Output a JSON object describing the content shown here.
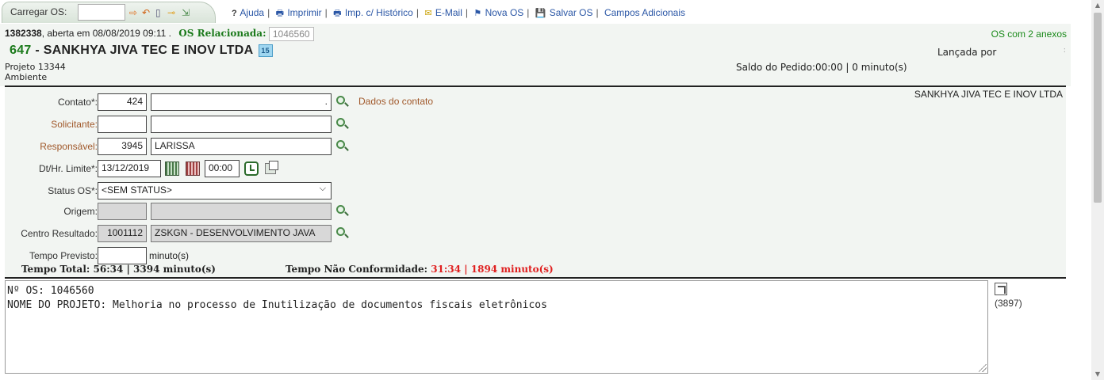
{
  "toolbar": {
    "load_label": "Carregar OS:",
    "load_value": "",
    "menu": [
      {
        "icon": "?",
        "label": "Ajuda"
      },
      {
        "icon": "🖶",
        "label": "Imprimir"
      },
      {
        "icon": "🖶",
        "label": "Imp. c/ Histórico"
      },
      {
        "icon": "✉",
        "label": "E-Mail"
      },
      {
        "icon": "⚑",
        "label": "Nova OS"
      },
      {
        "icon": "💾",
        "label": "Salvar OS"
      },
      {
        "icon": "",
        "label": "Campos Adicionais"
      }
    ]
  },
  "header": {
    "os_number": "1382338",
    "opened_text": ", aberta em 08/08/2019 09:11 .",
    "related_label": "OS Relacionada:",
    "related_value": "1046560",
    "attachments": "OS com 2 anexos",
    "company_code": "647",
    "company_sep": " - ",
    "company_name": "SANKHYA JIVA TEC E INOV LTDA",
    "calendar_badge": "15",
    "project": "Projeto 13344",
    "environment": "Ambiente",
    "launched_by": "Lançada por",
    "colon": ":",
    "balance": "Saldo do Pedido:00:00 | 0 minuto(s)"
  },
  "form": {
    "client_name": "SANKHYA JIVA TEC E INOV LTDA",
    "contato": {
      "label": "Contato*:",
      "code": "424",
      "name": "."
    },
    "contact_link": "Dados do contato",
    "solicitante": {
      "label": "Solicitante:",
      "code": "",
      "name": ""
    },
    "responsavel": {
      "label": "Responsável:",
      "code": "3945",
      "name": "LARISSA"
    },
    "limite": {
      "label": "Dt/Hr. Limite*:",
      "date": "13/12/2019",
      "time": "00:00"
    },
    "status": {
      "label": "Status OS*:",
      "value": "<SEM STATUS>"
    },
    "origem": {
      "label": "Origem:",
      "code": "",
      "name": ""
    },
    "centro": {
      "label": "Centro Resultado:",
      "code": "1001112",
      "name": "ZSKGN - DESENVOLVIMENTO JAVA"
    },
    "previsto": {
      "label": "Tempo Previsto:",
      "value": "",
      "unit": "minuto(s)"
    },
    "total_label": "Tempo Total: ",
    "total_value": "56:34 | 3394 minuto(s)",
    "nc_label": "Tempo Não Conformidade: ",
    "nc_value": "31:34 | 1894 minuto(s)"
  },
  "description": {
    "text": "Nº OS: 1046560\nNOME DO PROJETO: Melhoria no processo de Inutilização de documentos fiscais eletrônicos",
    "count": "(3897)"
  },
  "colors": {
    "accent_green": "#1b7a1b",
    "label_brown": "#a0582a",
    "link_blue": "#2b57a6",
    "alert_red": "#e02020"
  }
}
